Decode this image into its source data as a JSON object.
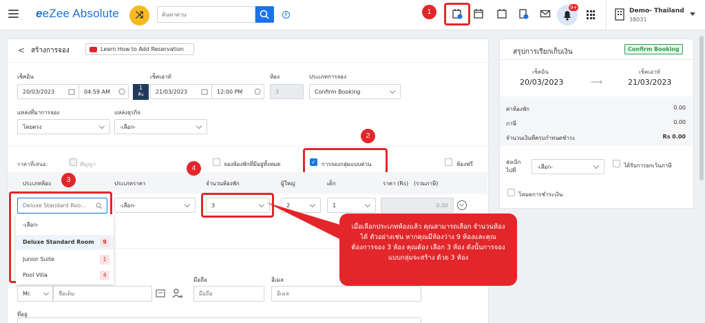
{
  "app": {
    "brand": "eZee Absolute",
    "search_placeholder": "ค้นหาด่วน",
    "notif_badge": "9+",
    "hotel_name": "Demo- Thailand",
    "hotel_id": "38031"
  },
  "annotations": {
    "n1": "1",
    "n2": "2",
    "n3": "3",
    "n4": "4"
  },
  "form": {
    "title": "สร้างการจอง",
    "help_label": "Learn How to Add Reservation",
    "checkin_label": "เช็คอิน",
    "checkin_date": "20/03/2023",
    "checkin_time": "04:59 AM",
    "nights": "1",
    "nights_unit": "คืน",
    "checkout_label": "เช็คเอาท์",
    "checkout_date": "21/03/2023",
    "checkout_time": "12:00 PM",
    "rooms_label": "ห้อง",
    "rooms_value": "3",
    "booking_type_label": "ประเภทการจอง",
    "booking_type_value": "Confirm Booking",
    "source_label": "แหล่งที่มาการจอง",
    "source_value": "โดยตรง",
    "business_label": "แหล่งธุรกิจ",
    "business_value": "-เลือก-",
    "rate_offer_label": "ราคาที่เสนอ:",
    "contract_label": "สัญญา",
    "reserve_available_label": "จองห้องพักที่มีอยู่ทั้งหมด",
    "group_booking_label": "การจองกลุ่มแบบด่วน",
    "free_room_label": "ห้องฟรี",
    "table": {
      "room_type": "ประเภทห้อง",
      "rate_type": "ประเภทราคา",
      "num_rooms": "จำนวนห้องพัก",
      "adult": "ผู้ใหญ่",
      "child": "เด็ก",
      "price": "ราคา (Rs)",
      "tax_incl": "(รวมภาษี)"
    },
    "row": {
      "room_search_placeholder": "Deluxe Standard Roo...",
      "rate_value": "-เลือก-",
      "num_rooms_value": "3",
      "adult_value": "2",
      "child_value": "1",
      "price_value": "0.00"
    },
    "room_options": [
      {
        "label": "-เลือก-",
        "count": ""
      },
      {
        "label": "Deluxe Standard Room",
        "count": "9"
      },
      {
        "label": "Junior Suite",
        "count": "1"
      },
      {
        "label": "Pool Villa",
        "count": "4"
      }
    ],
    "title_value": "Mr.",
    "name_placeholder": "ชื่อเต็ม",
    "mobile_label": "มือถือ",
    "mobile_placeholder": "มือถือ",
    "email_label": "อีเมล",
    "email_placeholder": "อีเมล",
    "address_label": "ที่อยู่"
  },
  "callout": "เมื่อเลือกประเภทห้องแล้ว คุณสามารถเลือก จำนวนห้องได้ ตัวอย่างเช่น หากคุณมีห้องว่าง 9 ห้องและคุณต้องการจอง 3 ห้อง คุณต้อง เลือก 3 ห้อง ดังนั้นการจองแบบกลุ่มจะสร้าง ด้วย 3 ห้อง",
  "summary": {
    "title": "สรุปการเรียกเก็บเงิน",
    "status": "Confirm Booking",
    "checkin_label": "เช็คอิน",
    "checkin_date": "20/03/2023",
    "checkout_label": "เช็คเอาท์",
    "checkout_date": "21/03/2023",
    "room_charge_label": "ค่าห้องพัก",
    "room_charge": "0.00",
    "tax_label": "ภาษี",
    "tax": "0.00",
    "due_label": "จำนวนเงินที่ครบกำหนดชำระ",
    "due": "Rs 0.00",
    "send_to_label1": "ส่งเบิก",
    "send_to_label2": "ไปที่",
    "send_to_value": "-เลือก-",
    "tax_exempt_label": "ได้รับการยกเว้นภาษี",
    "payment_mode_label": "โหมดการชำระเงิน"
  },
  "colors": {
    "brand": "#1a6fd1",
    "annotation": "#e3262a",
    "accent": "#1a73e8",
    "status_green": "#2e9e4f"
  }
}
